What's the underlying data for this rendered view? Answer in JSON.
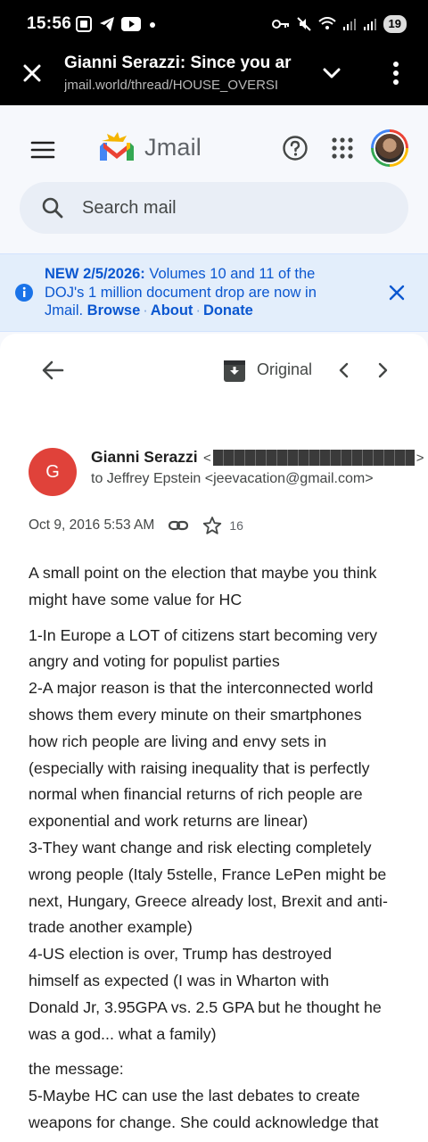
{
  "status_bar": {
    "time": "15:56",
    "left_icons": [
      "screenshot-icon",
      "telegram-icon",
      "youtube-icon",
      "dot-icon"
    ],
    "right_icons": [
      "key-icon",
      "mute-icon",
      "wifi-icon",
      "signal-icon",
      "signal-icon"
    ],
    "battery": "19"
  },
  "browser": {
    "title": "Gianni Serazzi: Since you ar",
    "url": "jmail.world/thread/HOUSE_OVERSI"
  },
  "app": {
    "logo_text": "Jmail",
    "search_placeholder": "Search mail",
    "colors": {
      "accent": "#0b57d0",
      "banner_bg": "#e3eefb",
      "avatar_bg": "#e0423a"
    }
  },
  "banner": {
    "headline": "NEW 2/5/2026:",
    "line1_rest": " Volumes 10 and 11 of the",
    "line2": "DOJ's 1 million document drop are now in",
    "line3_prefix": "Jmail. ",
    "links": [
      "Browse",
      "About",
      "Donate"
    ],
    "separator": "·"
  },
  "toolbar": {
    "original_label": "Original"
  },
  "email": {
    "sender_initial": "G",
    "sender_name": "Gianni Serazzi",
    "email_open": "<",
    "email_close": ">",
    "recipient": "to Jeffrey Epstein <jeevacation@gmail.com>",
    "date": "Oct 9, 2016 5:53 AM",
    "star_count": "16",
    "paragraphs": [
      [
        "A small point on the election that maybe you think",
        "might have some value for HC"
      ],
      [
        "1-In Europe a LOT of citizens start becoming very",
        "angry and voting for populist parties",
        "2-A major reason is that the interconnected world",
        "shows them every minute on their smartphones",
        "how rich people are living and envy sets in",
        "(especially with raising inequality that is perfectly",
        "normal when financial returns of rich people are",
        "exponential and work returns are linear)",
        "3-They want change and risk electing completely",
        "wrong people (Italy 5stelle, France LePen might be",
        "next, Hungary, Greece already lost, Brexit and anti-",
        "trade another example)",
        "4-US election is over, Trump has destroyed",
        "himself as expected (I was in Wharton with",
        "Donald Jr, 3.95GPA vs. 2.5 GPA but he thought he",
        "was a god... what a family)"
      ],
      [
        "the message:",
        "5-Maybe HC can use the last debates to create",
        "weapons for change. She could acknowledge that"
      ]
    ]
  }
}
